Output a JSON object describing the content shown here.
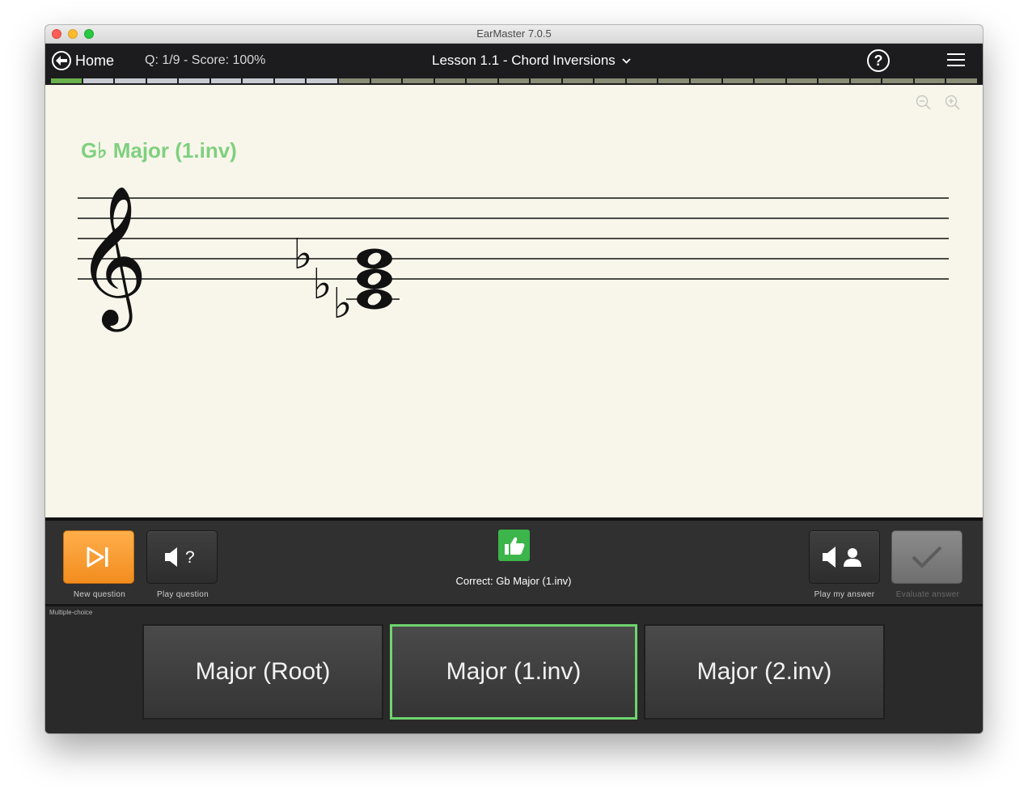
{
  "window": {
    "title": "EarMaster 7.0.5"
  },
  "topbar": {
    "home_label": "Home",
    "score_text": "Q: 1/9 - Score: 100%",
    "lesson_title": "Lesson 1.1 - Chord Inversions",
    "icons": [
      "back-arrow-icon",
      "chevron-down-icon",
      "help-icon",
      "hamburger-menu-icon"
    ]
  },
  "progress": {
    "segments": 29,
    "completed": 1,
    "colors": {
      "completed": "#6ab04c",
      "question": "#c9cbd3",
      "other": "#8a8c76"
    }
  },
  "notation": {
    "chord_label": "G♭ Major (1.inv)",
    "label_color": "#7fd07f",
    "clef": "treble",
    "accidentals": [
      "♭",
      "♭",
      "♭"
    ],
    "zoom_icons": [
      "zoom-out-icon",
      "zoom-in-icon"
    ]
  },
  "controls": {
    "new_question": "New question",
    "play_question": "Play question",
    "play_my_answer": "Play my answer",
    "evaluate_answer": "Evaluate answer",
    "feedback": "Correct: Gb Major (1.inv)",
    "accent": "#f7a030",
    "success": "#3cb54a"
  },
  "answers": {
    "section_label": "Multiple-choice",
    "options": [
      "Major (Root)",
      "Major (1.inv)",
      "Major (2.inv)"
    ],
    "selected": "Major (1.inv)",
    "selected_color": "#6fd36f"
  }
}
